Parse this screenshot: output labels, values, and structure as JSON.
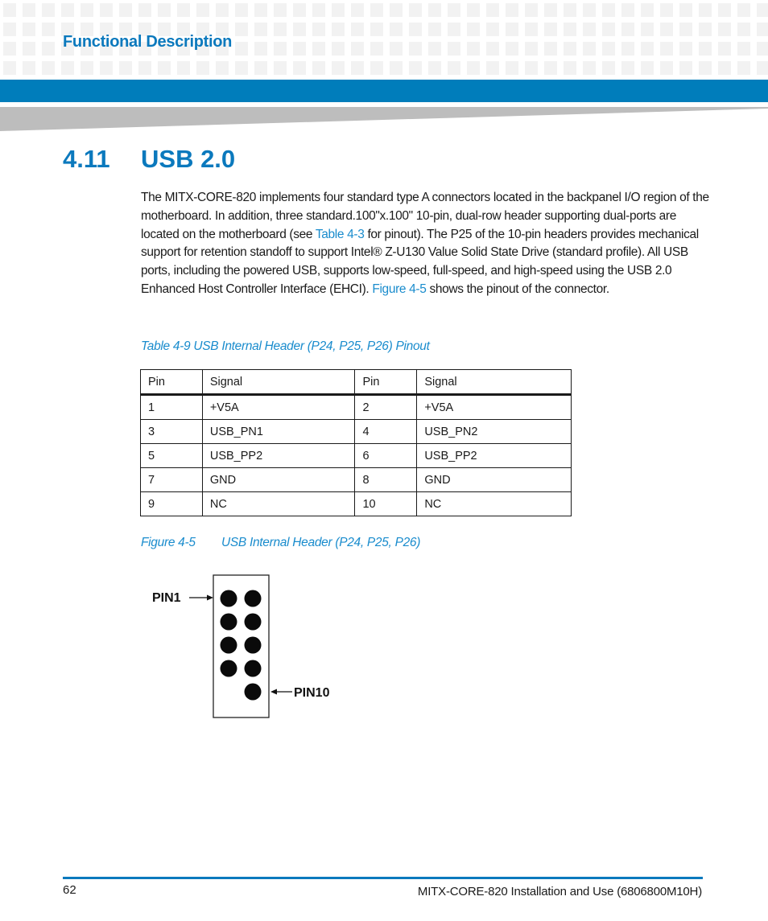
{
  "header": {
    "section_label": "Functional Description"
  },
  "section": {
    "number": "4.11",
    "title": "USB 2.0"
  },
  "body": {
    "p1_a": "The MITX-CORE-820 implements four standard type A connectors located in the backpanel I/O region of the motherboard. In addition, three standard.100\"x.100\" 10-pin, dual-row header supporting dual-ports are located on the motherboard (see ",
    "link_table": "Table 4-3",
    "p1_b": " for pinout). The P25 of the 10-pin headers provides mechanical support for retention standoff to support Intel® Z-U130 Value Solid State Drive (standard profile). All USB ports, including the powered USB, supports low-speed, full-speed, and high-speed using the USB 2.0 Enhanced Host Controller Interface (EHCI). ",
    "link_figure": "Figure 4-5",
    "p1_c": " shows the pinout of the connector."
  },
  "table": {
    "caption": "Table 4-9 USB Internal Header (P24, P25, P26) Pinout",
    "headers": [
      "Pin",
      "Signal",
      "Pin",
      "Signal"
    ],
    "rows": [
      [
        "1",
        "+V5A",
        "2",
        "+V5A"
      ],
      [
        "3",
        "USB_PN1",
        "4",
        "USB_PN2"
      ],
      [
        "5",
        "USB_PP2",
        "6",
        "USB_PP2"
      ],
      [
        "7",
        "GND",
        "8",
        "GND"
      ],
      [
        "9",
        "NC",
        "10",
        "NC"
      ]
    ]
  },
  "figure": {
    "caption_label": "Figure 4-5",
    "caption_title": "USB Internal Header (P24, P25, P26)",
    "pin1_label": "PIN1",
    "pin10_label": "PIN10",
    "pin_count": 10
  },
  "footer": {
    "page_number": "62",
    "doc_title": "MITX-CORE-820 Installation and Use (6806800M10H)"
  },
  "colors": {
    "brand_blue": "#007dbb",
    "link_blue": "#1a8ccd",
    "wedge_grey": "#bdbdbd"
  }
}
